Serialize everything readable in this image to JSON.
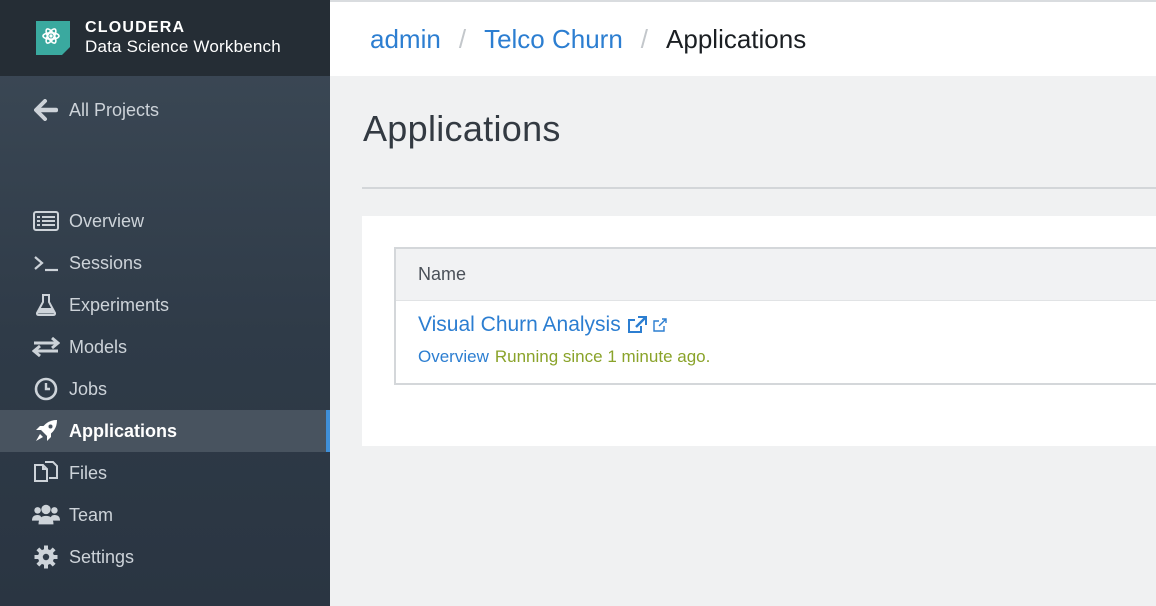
{
  "brand": {
    "name": "CLOUDERA",
    "product": "Data Science Workbench"
  },
  "sidebar": {
    "back_label": "All Projects",
    "items": [
      {
        "label": "Overview",
        "icon": "list-icon"
      },
      {
        "label": "Sessions",
        "icon": "terminal-icon"
      },
      {
        "label": "Experiments",
        "icon": "flask-icon"
      },
      {
        "label": "Models",
        "icon": "exchange-arrows-icon"
      },
      {
        "label": "Jobs",
        "icon": "clock-icon"
      },
      {
        "label": "Applications",
        "icon": "rocket-icon",
        "active": true
      },
      {
        "label": "Files",
        "icon": "files-icon"
      },
      {
        "label": "Team",
        "icon": "users-icon"
      },
      {
        "label": "Settings",
        "icon": "gear-icon"
      }
    ]
  },
  "breadcrumb": {
    "items": [
      "admin",
      "Telco Churn",
      "Applications"
    ],
    "separator": "/"
  },
  "main": {
    "title": "Applications",
    "table": {
      "column_name": "Name",
      "rows": [
        {
          "app_name": "Visual Churn Analysis",
          "overview_label": "Overview",
          "status": "Running since 1 minute ago."
        }
      ]
    }
  },
  "colors": {
    "sidebar_bg": "#36424e",
    "link_blue": "#2c7ed1",
    "status_green": "#8aa32a",
    "active_indicator": "#3f8fd8",
    "brand_teal": "#3aa99f"
  }
}
